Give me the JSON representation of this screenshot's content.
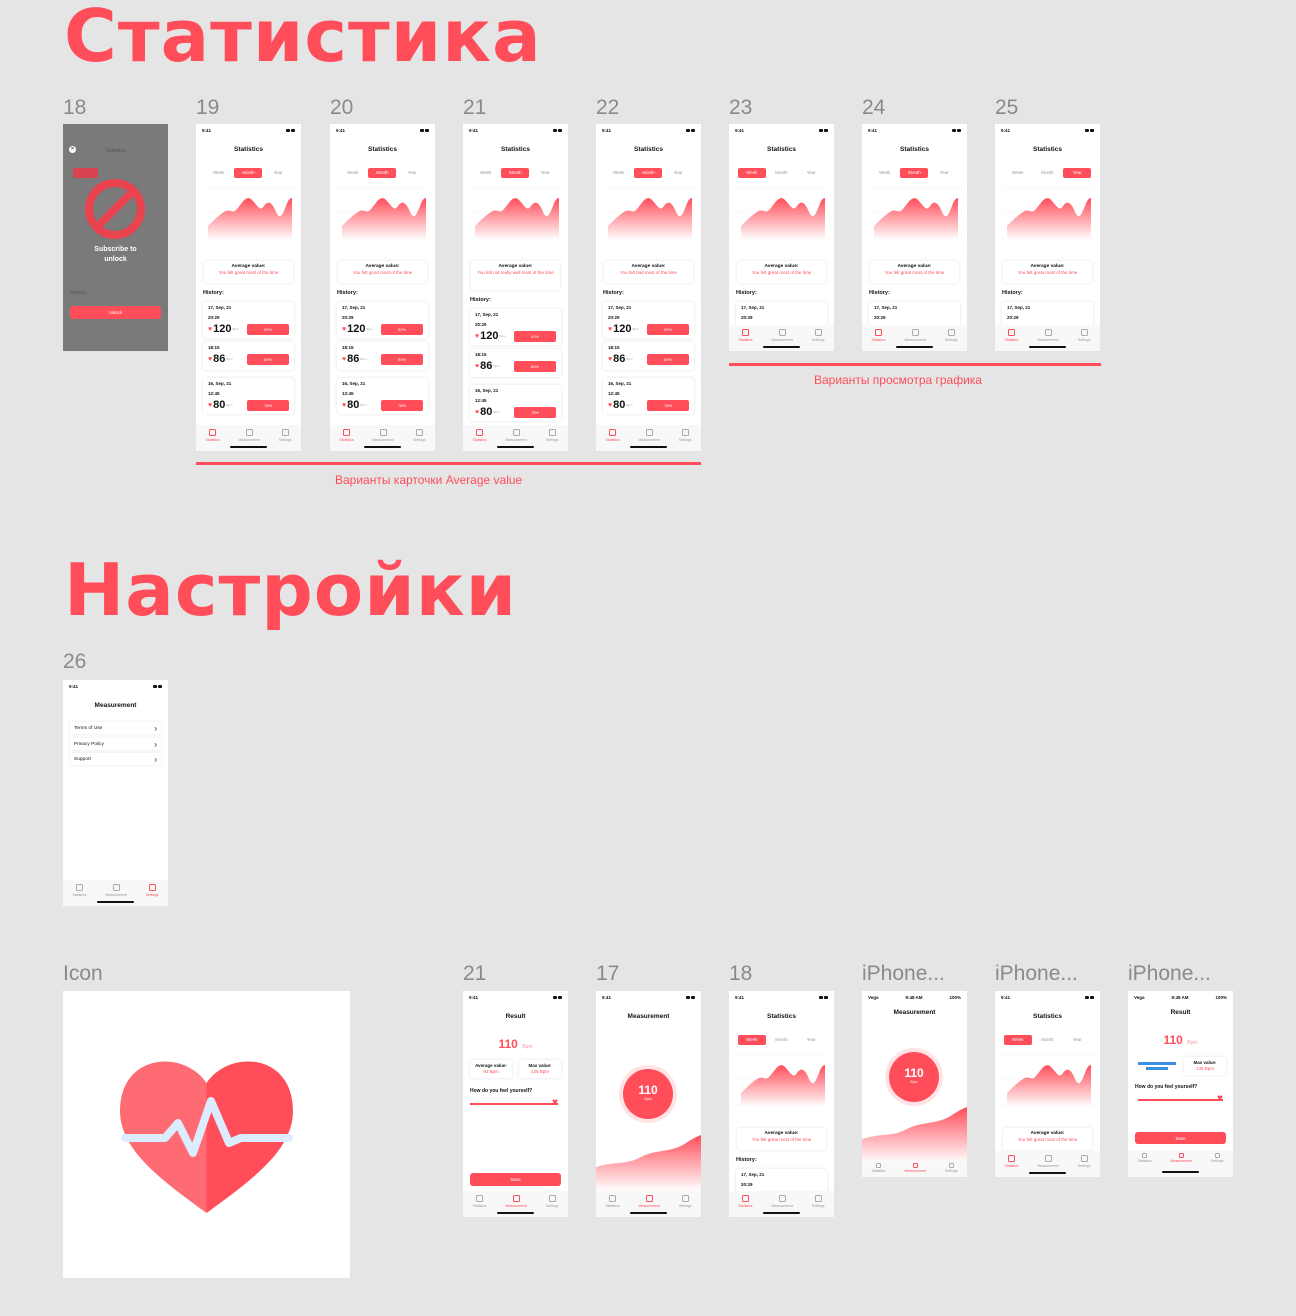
{
  "sections": {
    "statistics_title": "Статистика",
    "settings_title": "Настройки"
  },
  "frames": {
    "f18": "18",
    "f19": "19",
    "f20": "20",
    "f21": "21",
    "f22": "22",
    "f23": "23",
    "f24": "24",
    "f25": "25",
    "f26": "26",
    "icon": "Icon",
    "b21": "21",
    "b17": "17",
    "b18": "18",
    "iphone1": "iPhone...",
    "iphone2": "iPhone...",
    "iphone3": "iPhone..."
  },
  "captions": {
    "avg_variants": "Варианты карточки Average value",
    "chart_variants": "Варианты просмотра графика"
  },
  "common": {
    "time": "9:41",
    "stats_title": "Statistics",
    "week": "Week",
    "month": "Month",
    "year": "Year",
    "average_label": "Average value:",
    "history": "History:",
    "date1": "17, Sep, 21",
    "time1": "20:29",
    "bpm1": "120",
    "time2": "18:15",
    "bpm2": "86",
    "date3": "16, Sep, 21",
    "time3": "12:45",
    "bpm3": "80",
    "unit": "Bpm",
    "tab_statistics": "Statistics",
    "tab_measurement": "Measurement",
    "tab_settings": "Settings"
  },
  "paywall": {
    "title": "Statistics",
    "subscribe": "Subscribe to unlock",
    "unlock": "Unlock",
    "history": "History:"
  },
  "avg_messages": {
    "great": "You felt great most of the time",
    "good": "You felt good most of the time",
    "not_well": "You felt not really well most of the time",
    "bad": "You felt bad most of the time"
  },
  "pills": {
    "p1": "92%",
    "p2": "80%",
    "p3": "78%"
  },
  "settings": {
    "title": "Measurement",
    "items": [
      "Terms of Use",
      "Privacy Policy",
      "Support"
    ]
  },
  "result": {
    "title": "Result",
    "value": "110",
    "unit": "Bpm",
    "avg_label": "Average value:",
    "avg_value": "92 Bpm",
    "max_label": "Max value:",
    "max_value": "135 Bpm",
    "question": "How do you feel yourself?",
    "save": "Save"
  },
  "measurement": {
    "title": "Measurement",
    "value": "110",
    "unit": "Bpm"
  },
  "carrier": {
    "left": "Vega",
    "time": "9:48 AM",
    "battery": "100%"
  },
  "colors": {
    "accent": "#ff4d5a",
    "background": "#e5e5e5"
  }
}
